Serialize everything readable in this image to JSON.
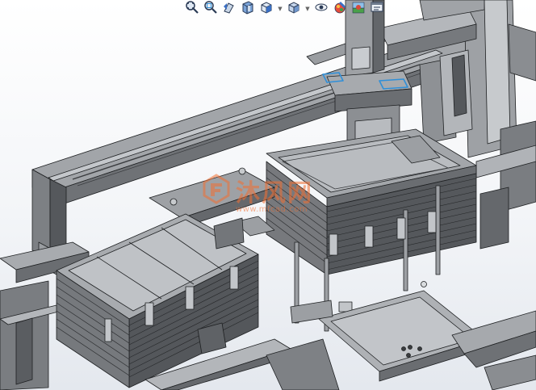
{
  "viewport": {
    "name": "solidworks-3d-viewport"
  },
  "heads_up_toolbar": {
    "tools": [
      {
        "name": "zoom-to-fit",
        "icon": "zoom-to-fit-icon"
      },
      {
        "name": "zoom-to-area",
        "icon": "zoom-to-area-icon"
      },
      {
        "name": "previous-view",
        "icon": "previous-view-icon"
      },
      {
        "name": "section-view",
        "icon": "section-view-icon"
      },
      {
        "name": "view-orientation",
        "icon": "view-orientation-icon"
      },
      {
        "name": "display-style",
        "icon": "display-style-icon"
      },
      {
        "name": "hide-show-items",
        "icon": "hide-show-icon"
      },
      {
        "name": "edit-appearance",
        "icon": "edit-appearance-icon"
      },
      {
        "name": "apply-scene",
        "icon": "apply-scene-icon"
      },
      {
        "name": "view-settings",
        "icon": "view-settings-icon"
      }
    ]
  },
  "watermark": {
    "text": "沐风网",
    "url": "www.mfcad.com",
    "color": "#f36f31"
  },
  "colors": {
    "part": "#8f9296",
    "part_dark": "#4f5256",
    "part_light": "#b8bbbf",
    "edge": "#1e2022",
    "highlight": "#2f8fd8"
  }
}
